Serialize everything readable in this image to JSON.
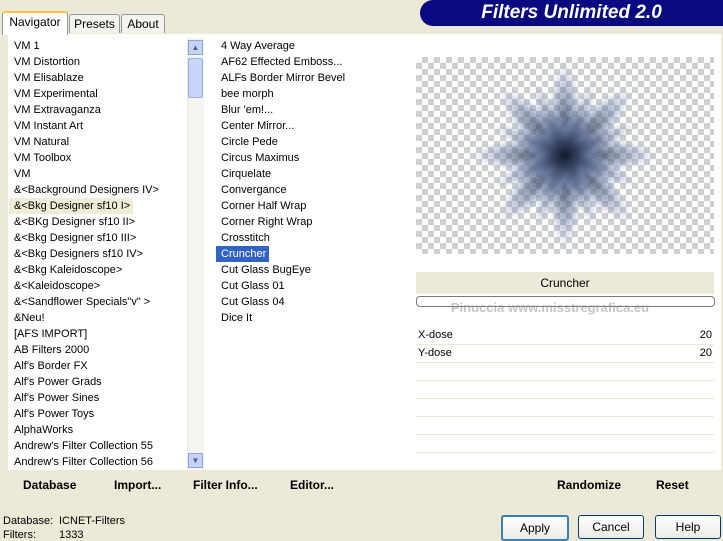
{
  "tabs": [
    "Navigator",
    "Presets",
    "About"
  ],
  "banner": "Filters Unlimited 2.0",
  "categories": {
    "items": [
      "VM 1",
      "VM Distortion",
      "VM Elisablaze",
      "VM Experimental",
      "VM Extravaganza",
      "VM Instant Art",
      "VM Natural",
      "VM Toolbox",
      "VM",
      "&<Background Designers IV>",
      "&<Bkg Designer sf10 I>",
      "&<BKg Designer sf10 II>",
      "&<Bkg Designer sf10 III>",
      "&<Bkg Designers sf10 IV>",
      "&<Bkg Kaleidoscope>",
      "&<Kaleidoscope>",
      "&<Sandflower Specials\"v\" >",
      "&Neu!",
      "[AFS IMPORT]",
      "AB Filters 2000",
      "Alf's Border FX",
      "Alf's Power Grads",
      "Alf's Power Sines",
      "Alf's Power Toys",
      "AlphaWorks",
      "Andrew's Filter Collection 55",
      "Andrew's Filter Collection 56"
    ],
    "selected_index": 10
  },
  "filters": {
    "items": [
      "4 Way Average",
      "AF62 Effected Emboss...",
      "ALFs Border Mirror Bevel",
      "bee morph",
      "Blur 'em!...",
      "Center Mirror...",
      "Circle Pede",
      "Circus Maximus",
      "Cirquelate",
      "Convergance",
      "Corner Half Wrap",
      "Corner Right Wrap",
      "Crosstitch",
      "Cruncher",
      "Cut Glass  BugEye",
      "Cut Glass 01",
      "Cut Glass 04",
      "Dice It"
    ],
    "selected_index": 13
  },
  "preview": {
    "filter_name": "Cruncher",
    "progress": 0,
    "watermark": "Pinuccia www.misstregrafica.eu"
  },
  "params": [
    {
      "name": "X-dose",
      "value": "20"
    },
    {
      "name": "Y-dose",
      "value": "20"
    }
  ],
  "bottom_links": {
    "database": "Database",
    "import": "Import...",
    "filter_info": "Filter Info...",
    "editor": "Editor...",
    "randomize": "Randomize",
    "reset": "Reset"
  },
  "status": {
    "database_label": "Database:",
    "database_value": "ICNET-Filters",
    "filters_label": "Filters:",
    "filters_value": "1333"
  },
  "buttons": {
    "apply": "Apply",
    "cancel": "Cancel",
    "help": "Help"
  },
  "colors": {
    "selection": "#3163c5",
    "banner": "#0a0a80",
    "tab_highlight": "#ffc83c"
  }
}
